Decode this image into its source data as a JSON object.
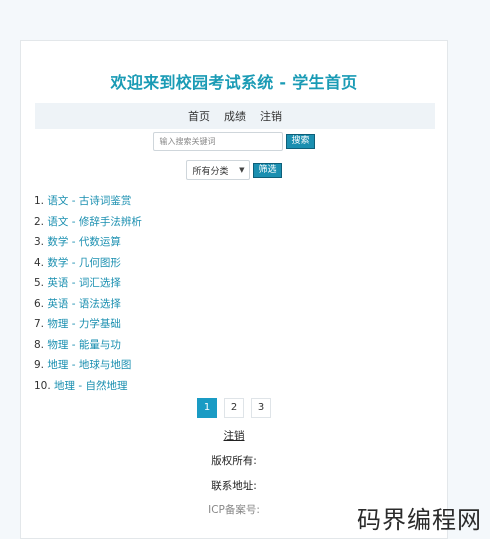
{
  "title": "欢迎来到校园考试系统 - 学生首页",
  "nav": [
    "首页",
    "成绩",
    "注销"
  ],
  "search": {
    "placeholder": "输入搜索关键词",
    "button": "搜索"
  },
  "filter": {
    "selected": "所有分类",
    "button": "筛选"
  },
  "exams": [
    {
      "num": "1.",
      "title": "语文 - 古诗词鉴赏"
    },
    {
      "num": "2.",
      "title": "语文 - 修辞手法辨析"
    },
    {
      "num": "3.",
      "title": "数学 - 代数运算"
    },
    {
      "num": "4.",
      "title": "数学 - 几何图形"
    },
    {
      "num": "5.",
      "title": "英语 - 词汇选择"
    },
    {
      "num": "6.",
      "title": "英语 - 语法选择"
    },
    {
      "num": "7.",
      "title": "物理 - 力学基础"
    },
    {
      "num": "8.",
      "title": "物理 - 能量与功"
    },
    {
      "num": "9.",
      "title": "地理 - 地球与地图"
    },
    {
      "num": "10.",
      "title": "地理 - 自然地理"
    }
  ],
  "pagination": {
    "pages": [
      "1",
      "2",
      "3"
    ],
    "current": "1"
  },
  "footer": {
    "logout": "注销",
    "copyright": "版权所有:",
    "address": "联系地址:",
    "icp": "ICP备案号:"
  },
  "watermark": "码界编程网",
  "colors": {
    "accent": "#1a9bb5",
    "button": "#1b8fb0",
    "link": "#1a8fb0"
  }
}
